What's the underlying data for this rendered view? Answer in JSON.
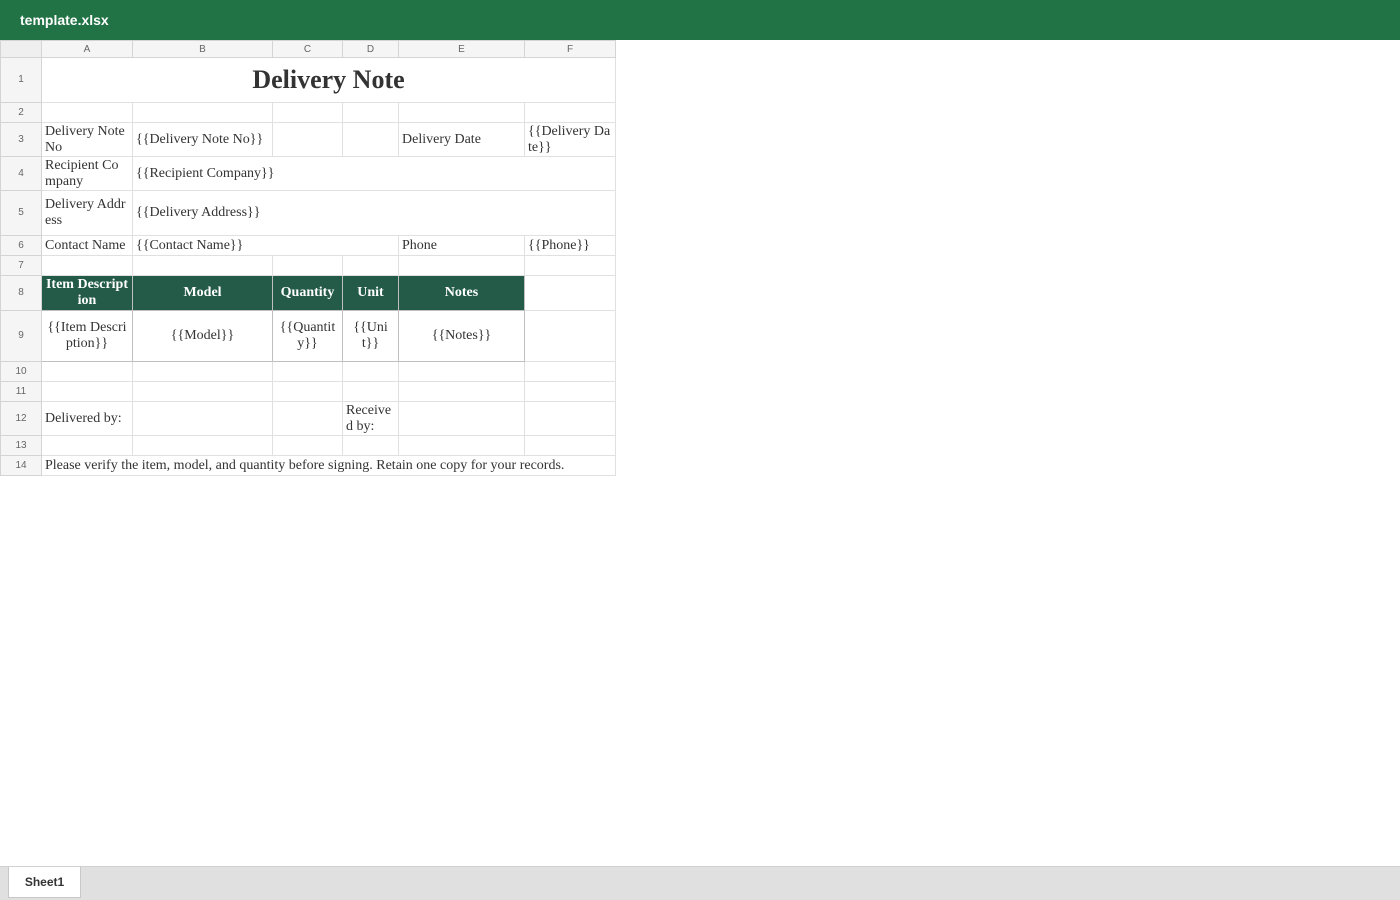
{
  "window": {
    "title": "template.xlsx"
  },
  "columns": [
    "A",
    "B",
    "C",
    "D",
    "E",
    "F"
  ],
  "rows": [
    "1",
    "2",
    "3",
    "4",
    "5",
    "6",
    "7",
    "8",
    "9",
    "10",
    "11",
    "12",
    "13",
    "14"
  ],
  "cells": {
    "title": "Delivery Note",
    "delivery_note_no_label": "Delivery Note No",
    "delivery_note_no_value": "{{Delivery Note No}}",
    "delivery_date_label": "Delivery Date",
    "delivery_date_value": "{{Delivery Date}}",
    "recipient_company_label": "Recipient Company",
    "recipient_company_value": "{{Recipient Company}}",
    "delivery_address_label": "Delivery Address",
    "delivery_address_value": "{{Delivery Address}}",
    "contact_name_label": "Contact Name",
    "contact_name_value": "{{Contact Name}}",
    "phone_label": "Phone",
    "phone_value": "{{Phone}}",
    "items_table": {
      "headers": [
        "Item Description",
        "Model",
        "Quantity",
        "Unit",
        "Notes"
      ],
      "row": [
        "{{Item Description}}",
        "{{Model}}",
        "{{Quantity}}",
        "{{Unit}}",
        "{{Notes}}"
      ]
    },
    "delivered_by_label": "Delivered by:",
    "received_by_label": "Received by:",
    "footer_note": "Please verify the item, model, and quantity before signing. Retain one copy for your records."
  },
  "sheet_tabs": [
    "Sheet1"
  ],
  "colors": {
    "titlebar": "#217346",
    "table_header": "#235b48"
  }
}
